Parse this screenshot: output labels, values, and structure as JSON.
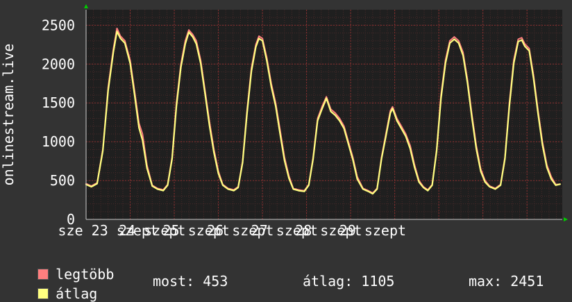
{
  "chart_data": {
    "type": "line",
    "ylabel": "onlinestream.live",
    "ylim": [
      0,
      2700
    ],
    "yticks": [
      0,
      500,
      1000,
      1500,
      2000,
      2500
    ],
    "xlim": [
      0,
      7.9
    ],
    "x_tick_labels": [
      "sze 23 szept",
      "24 szept",
      "25 szept",
      "26 szept",
      "27 szept",
      "28 szept",
      "29 szept"
    ],
    "grid": true,
    "colors": {
      "background": "#333333",
      "plot_area": "#1f1f1f",
      "grid": "#6a2a2a",
      "legtobb": "#ff7f7f",
      "atlag": "#ffff80",
      "axis_arrow": "#00cc00"
    },
    "series": [
      {
        "name": "legtöbb",
        "points": [
          [
            0.0,
            460
          ],
          [
            0.12,
            430
          ],
          [
            0.25,
            470
          ],
          [
            0.38,
            900
          ],
          [
            0.5,
            1700
          ],
          [
            0.62,
            2200
          ],
          [
            0.7,
            2460
          ],
          [
            0.78,
            2360
          ],
          [
            0.88,
            2300
          ],
          [
            1.0,
            2050
          ],
          [
            1.1,
            1650
          ],
          [
            1.2,
            1240
          ],
          [
            1.28,
            1100
          ],
          [
            1.38,
            700
          ],
          [
            1.5,
            440
          ],
          [
            1.62,
            400
          ],
          [
            1.75,
            380
          ],
          [
            1.85,
            450
          ],
          [
            1.95,
            800
          ],
          [
            2.05,
            1500
          ],
          [
            2.15,
            2000
          ],
          [
            2.25,
            2300
          ],
          [
            2.33,
            2440
          ],
          [
            2.42,
            2380
          ],
          [
            2.5,
            2300
          ],
          [
            2.6,
            2050
          ],
          [
            2.7,
            1650
          ],
          [
            2.8,
            1250
          ],
          [
            2.9,
            900
          ],
          [
            3.0,
            620
          ],
          [
            3.1,
            450
          ],
          [
            3.22,
            400
          ],
          [
            3.35,
            380
          ],
          [
            3.45,
            420
          ],
          [
            3.55,
            750
          ],
          [
            3.65,
            1400
          ],
          [
            3.75,
            1950
          ],
          [
            3.85,
            2250
          ],
          [
            3.92,
            2360
          ],
          [
            4.0,
            2330
          ],
          [
            4.1,
            2080
          ],
          [
            4.2,
            1750
          ],
          [
            4.3,
            1500
          ],
          [
            4.4,
            1150
          ],
          [
            4.5,
            800
          ],
          [
            4.6,
            560
          ],
          [
            4.7,
            400
          ],
          [
            4.82,
            380
          ],
          [
            4.95,
            370
          ],
          [
            5.05,
            450
          ],
          [
            5.15,
            800
          ],
          [
            5.25,
            1300
          ],
          [
            5.35,
            1450
          ],
          [
            5.45,
            1580
          ],
          [
            5.55,
            1420
          ],
          [
            5.65,
            1370
          ],
          [
            5.75,
            1300
          ],
          [
            5.85,
            1200
          ],
          [
            5.95,
            1000
          ],
          [
            6.05,
            800
          ],
          [
            6.15,
            550
          ],
          [
            6.28,
            400
          ],
          [
            6.4,
            370
          ],
          [
            6.5,
            340
          ],
          [
            6.6,
            400
          ],
          [
            6.7,
            800
          ],
          [
            6.8,
            1100
          ],
          [
            6.9,
            1400
          ],
          [
            6.95,
            1450
          ],
          [
            7.05,
            1300
          ],
          [
            7.15,
            1200
          ],
          [
            7.25,
            1100
          ],
          [
            7.35,
            950
          ],
          [
            7.45,
            700
          ],
          [
            7.55,
            500
          ],
          [
            7.65,
            420
          ],
          [
            7.75,
            380
          ],
          [
            7.85,
            450
          ],
          [
            7.95,
            900
          ],
          [
            8.05,
            1600
          ],
          [
            8.15,
            2050
          ],
          [
            8.25,
            2300
          ],
          [
            8.35,
            2350
          ],
          [
            8.45,
            2300
          ],
          [
            8.55,
            2150
          ],
          [
            8.65,
            1800
          ],
          [
            8.75,
            1350
          ],
          [
            8.85,
            950
          ],
          [
            8.95,
            650
          ],
          [
            9.05,
            500
          ],
          [
            9.15,
            430
          ],
          [
            9.28,
            400
          ],
          [
            9.4,
            450
          ],
          [
            9.5,
            800
          ],
          [
            9.6,
            1500
          ],
          [
            9.7,
            2050
          ],
          [
            9.8,
            2320
          ],
          [
            9.88,
            2340
          ],
          [
            9.95,
            2260
          ],
          [
            10.05,
            2200
          ],
          [
            10.15,
            1850
          ],
          [
            10.25,
            1400
          ],
          [
            10.35,
            1000
          ],
          [
            10.45,
            700
          ],
          [
            10.55,
            550
          ],
          [
            10.65,
            450
          ],
          [
            10.75,
            453
          ]
        ]
      },
      {
        "name": "átlag",
        "points": [
          [
            0.0,
            450
          ],
          [
            0.12,
            420
          ],
          [
            0.25,
            460
          ],
          [
            0.38,
            880
          ],
          [
            0.5,
            1660
          ],
          [
            0.62,
            2160
          ],
          [
            0.7,
            2420
          ],
          [
            0.78,
            2330
          ],
          [
            0.88,
            2270
          ],
          [
            1.0,
            2010
          ],
          [
            1.1,
            1600
          ],
          [
            1.2,
            1180
          ],
          [
            1.28,
            1020
          ],
          [
            1.38,
            660
          ],
          [
            1.5,
            430
          ],
          [
            1.62,
            390
          ],
          [
            1.75,
            370
          ],
          [
            1.85,
            440
          ],
          [
            1.95,
            780
          ],
          [
            2.05,
            1460
          ],
          [
            2.15,
            1960
          ],
          [
            2.25,
            2260
          ],
          [
            2.33,
            2410
          ],
          [
            2.42,
            2350
          ],
          [
            2.5,
            2260
          ],
          [
            2.6,
            2010
          ],
          [
            2.7,
            1610
          ],
          [
            2.8,
            1200
          ],
          [
            2.9,
            860
          ],
          [
            3.0,
            590
          ],
          [
            3.1,
            440
          ],
          [
            3.22,
            390
          ],
          [
            3.35,
            370
          ],
          [
            3.45,
            410
          ],
          [
            3.55,
            730
          ],
          [
            3.65,
            1360
          ],
          [
            3.75,
            1910
          ],
          [
            3.85,
            2220
          ],
          [
            3.92,
            2330
          ],
          [
            4.0,
            2300
          ],
          [
            4.1,
            2040
          ],
          [
            4.2,
            1710
          ],
          [
            4.3,
            1460
          ],
          [
            4.4,
            1100
          ],
          [
            4.5,
            760
          ],
          [
            4.6,
            530
          ],
          [
            4.7,
            390
          ],
          [
            4.82,
            370
          ],
          [
            4.95,
            360
          ],
          [
            5.05,
            440
          ],
          [
            5.15,
            780
          ],
          [
            5.25,
            1270
          ],
          [
            5.35,
            1420
          ],
          [
            5.45,
            1560
          ],
          [
            5.55,
            1390
          ],
          [
            5.65,
            1340
          ],
          [
            5.75,
            1270
          ],
          [
            5.85,
            1170
          ],
          [
            5.95,
            970
          ],
          [
            6.05,
            770
          ],
          [
            6.15,
            520
          ],
          [
            6.28,
            390
          ],
          [
            6.4,
            360
          ],
          [
            6.5,
            330
          ],
          [
            6.6,
            390
          ],
          [
            6.7,
            780
          ],
          [
            6.8,
            1070
          ],
          [
            6.9,
            1370
          ],
          [
            6.95,
            1430
          ],
          [
            7.05,
            1270
          ],
          [
            7.15,
            1170
          ],
          [
            7.25,
            1070
          ],
          [
            7.35,
            910
          ],
          [
            7.45,
            670
          ],
          [
            7.55,
            480
          ],
          [
            7.65,
            410
          ],
          [
            7.75,
            370
          ],
          [
            7.85,
            440
          ],
          [
            7.95,
            880
          ],
          [
            8.05,
            1560
          ],
          [
            8.15,
            2010
          ],
          [
            8.25,
            2270
          ],
          [
            8.35,
            2320
          ],
          [
            8.45,
            2270
          ],
          [
            8.55,
            2110
          ],
          [
            8.65,
            1760
          ],
          [
            8.75,
            1310
          ],
          [
            8.85,
            910
          ],
          [
            8.95,
            620
          ],
          [
            9.05,
            480
          ],
          [
            9.15,
            420
          ],
          [
            9.28,
            390
          ],
          [
            9.4,
            440
          ],
          [
            9.5,
            780
          ],
          [
            9.6,
            1460
          ],
          [
            9.7,
            2010
          ],
          [
            9.8,
            2290
          ],
          [
            9.88,
            2310
          ],
          [
            9.95,
            2230
          ],
          [
            10.05,
            2170
          ],
          [
            10.15,
            1810
          ],
          [
            10.25,
            1360
          ],
          [
            10.35,
            960
          ],
          [
            10.45,
            670
          ],
          [
            10.55,
            520
          ],
          [
            10.65,
            440
          ],
          [
            10.75,
            453
          ]
        ]
      }
    ],
    "legend": [
      {
        "label": "legtöbb",
        "color": "#ff7f7f"
      },
      {
        "label": "átlag",
        "color": "#ffff80"
      }
    ],
    "stats": {
      "most": "most: 453",
      "atlag": "átlag: 1105",
      "max": "max: 2451"
    }
  }
}
